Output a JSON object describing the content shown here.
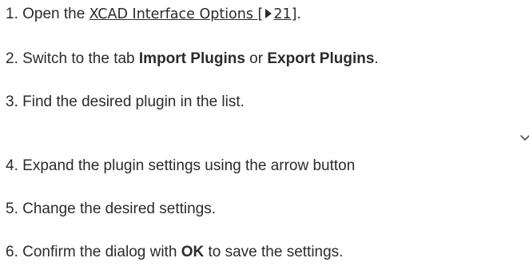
{
  "steps": [
    {
      "number": "1.",
      "before": "Open the ",
      "link_text": "XCAD Interface Options [",
      "link_ref": "21]",
      "after": "."
    },
    {
      "number": "2.",
      "before": "Switch to the tab ",
      "bold1": "Import Plugins",
      "middle": " or ",
      "bold2": "Export Plugins",
      "after": "."
    },
    {
      "number": "3.",
      "text": "Find the desired plugin in the list."
    },
    {
      "number": "4.",
      "text": "Expand the plugin settings using the arrow button",
      "icon": "chevron-down-icon"
    },
    {
      "number": "5.",
      "text": "Change the desired settings."
    },
    {
      "number": "6.",
      "before": "Confirm the dialog with ",
      "bold": "OK",
      "after": " to save the settings."
    }
  ]
}
